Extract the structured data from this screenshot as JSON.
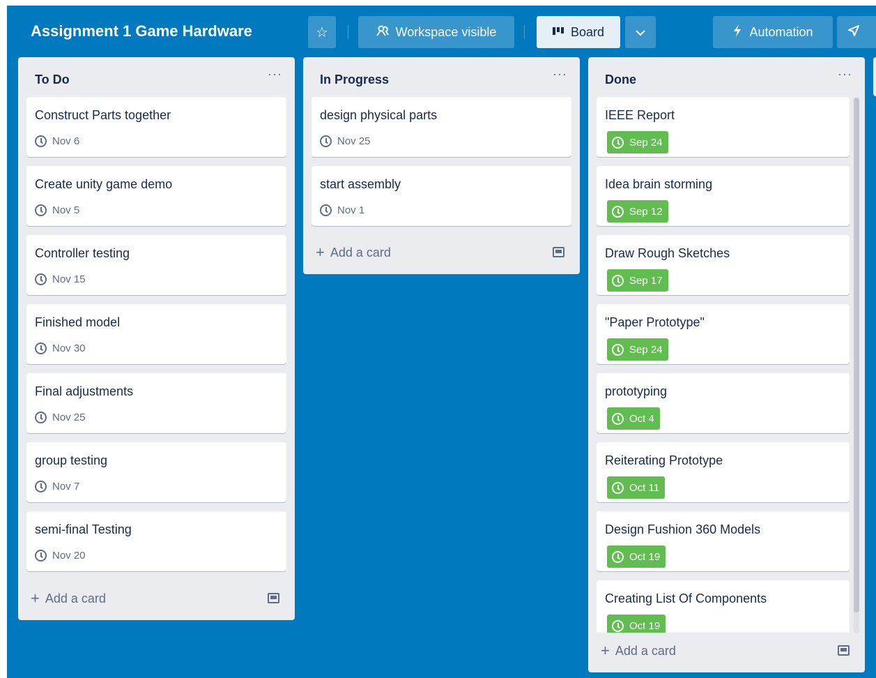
{
  "header": {
    "board_title": "Assignment 1 Game Hardware",
    "star_icon": "star-icon",
    "visibility_label": "Workspace visible",
    "view_label": "Board",
    "automation_label": "Automation",
    "colors": {
      "background": "#0079bf",
      "button_active": "#e4f0f6"
    }
  },
  "lists": {
    "todo": {
      "title": "To Do",
      "menu": "···",
      "add_card_label": "Add a card",
      "cards": [
        {
          "title": "Construct Parts together",
          "due": "Nov 6"
        },
        {
          "title": "Create unity game demo",
          "due": "Nov 5"
        },
        {
          "title": "Controller testing",
          "due": "Nov 15"
        },
        {
          "title": "Finished model",
          "due": "Nov 30"
        },
        {
          "title": "Final adjustments",
          "due": "Nov 25"
        },
        {
          "title": "group testing",
          "due": "Nov 7"
        },
        {
          "title": "semi-final Testing",
          "due": "Nov 20"
        }
      ]
    },
    "inprogress": {
      "title": "In Progress",
      "menu": "···",
      "add_card_label": "Add a card",
      "cards": [
        {
          "title": "design physical parts",
          "due": "Nov 25"
        },
        {
          "title": "start assembly",
          "due": "Nov 1"
        }
      ]
    },
    "done": {
      "title": "Done",
      "menu": "···",
      "add_card_label": "Add a card",
      "due_complete_color": "#61bd4f",
      "cards": [
        {
          "title": "IEEE Report",
          "due": "Sep 24"
        },
        {
          "title": "Idea brain storming",
          "due": "Sep 12"
        },
        {
          "title": "Draw Rough Sketches",
          "due": "Sep 17"
        },
        {
          "title": "\"Paper Prototype\"",
          "due": "Sep 24"
        },
        {
          "title": "prototyping",
          "due": "Oct 4"
        },
        {
          "title": "Reiterating Prototype",
          "due": "Oct 11"
        },
        {
          "title": "Design Fushion 360 Models",
          "due": "Oct 19"
        },
        {
          "title": "Creating List Of Components",
          "due": "Oct 19"
        }
      ]
    }
  }
}
